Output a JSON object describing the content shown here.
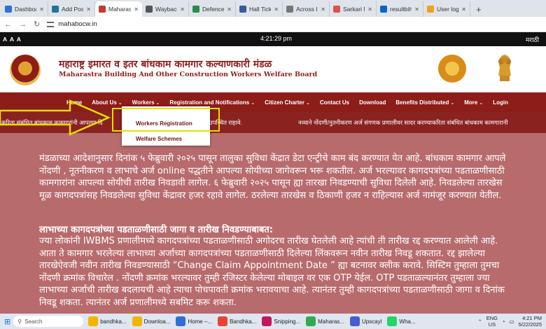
{
  "browser": {
    "tabs": [
      {
        "label": "Dashboard",
        "color": "#2f6fd6"
      },
      {
        "label": "Add Post",
        "color": "#21759b"
      },
      {
        "label": "Maharashtra",
        "color": "#c23a2b",
        "active": true
      },
      {
        "label": "Wayback",
        "color": "#555555"
      },
      {
        "label": "Defence J",
        "color": "#2a8c4a"
      },
      {
        "label": "Hall Ticket",
        "color": "#3b5998"
      },
      {
        "label": "Across Ind",
        "color": "#777777"
      },
      {
        "label": "Sarkari N",
        "color": "#d9534f"
      },
      {
        "label": "resultbiha",
        "color": "#0a66c2"
      },
      {
        "label": "User login",
        "color": "#f0a020"
      }
    ],
    "new_tab": "+",
    "url": "mahabocw.in"
  },
  "topbar": {
    "font_controls": "A A A",
    "time": "4:21:29 pm",
    "language": "मराठी"
  },
  "header": {
    "title_marathi": "महाराष्ट्र इमारत व इतर बांधकाम कामगार कल्याणकारी मंडळ",
    "title_english": "Maharastra Building And Other Construction Workers Welfare Board"
  },
  "nav": {
    "items": [
      {
        "label": "Home",
        "caret": false
      },
      {
        "label": "About Us",
        "caret": true
      },
      {
        "label": "Workers",
        "caret": true
      },
      {
        "label": "Registration and Notifications",
        "caret": true
      },
      {
        "label": "Citizen Charter",
        "caret": true
      },
      {
        "label": "Contact Us",
        "caret": false
      },
      {
        "label": "Download",
        "caret": false
      },
      {
        "label": "Benefits Distributed",
        "caret": true
      },
      {
        "label": "More",
        "caret": true
      },
      {
        "label": "Login",
        "caret": false
      }
    ],
    "caret_glyph": "⌄"
  },
  "ticker": {
    "part1": "करिता संबंधित बांधकाम कामगारांनी आपल्या दि",
    "part2": "सुविधा केंद्रात उपस्थित राहावे.",
    "part3": "नव्याने नोंदणी/नुतनीकरण अर्ज संगणक प्रणालीवर सादर करण्याकरिता संबंधित बांधकाम कामगारानी"
  },
  "dropdown": {
    "items": [
      "Workers Registration",
      "Welfare Schemes"
    ]
  },
  "content": {
    "paragraph1": "मंडळाच्या आदेशानुसार दिनांक ५ फेब्रुवारी २०२५ पासून तालुका सुविधा केंद्रात डेटा एन्ट्रीचे काम बंद करण्यात येत आहे. बांधकाम कामगार आपले नोंदणी , नूतनीकरण व लाभाचे अर्ज online पद्धतीने आपल्या सोयीच्या जागेवरून भरू शकतील. अर्ज भरल्यावर कागदपत्रांच्या पडताळणीसाठी कामगारांना आपल्या सोयीची तारीख निवडावी लागेल. ६ फेब्रुवारी २०२५ पासून ह्या तारखा निवडण्याची सुविधा दिलेली आहे. निवडलेल्या तारखेस मूळ कागदपत्रांसह निवडलेल्या सुविधा केंद्रावर हजर रहावे लागेल. ठरलेल्या तारखेस व ठिकाणी हजर न राहिल्यास अर्ज नामंजूर करण्यात येतील.",
    "heading": "लाभाच्या कागदपत्रांच्या पडताळणीसाठी जागा व तारीख निवडण्याबाबत:",
    "paragraph2": "ज्या लोकांनी IWBMS प्रणालीमध्ये कागदपत्रांच्या पडताळणीसाठी अगोदरच तारीख घेतलेली आहे त्यांची ती तारीख रद्द करण्यात आलेली आहे. आता ते कामगार भरलेल्या लाभाच्या अर्जाच्या कागदपत्रांच्या पडताळणीसाठी दिलेल्या लिंकवरून नवीन तारीख निवडू शकतात. रद्द झालेल्या तारखेऐवजी नवीन तारीख निवडण्यासाठी “Change Claim Appointment Date ” ह्या बटनावर क्लीक करावे. सिस्टिम तुम्हाला तुमचा नोंदणी क्रमांक विचारेल . नोंदणी क्रमांक भरल्यावर तुम्ही रजिस्टर केलेल्या मोबाइल वर एक OTP येईल. OTP पडताळल्यानंतर तुम्हाला ज्या लाभाच्या अर्जाची तारीख बदलायची आहे त्याचा पोचपावती क्रमांक भरावयाचा आहे. त्यानंतर तुम्ही कागदपत्रांच्या पडताळणीसाठी जागा व दिनांक निवडू शकता. त्यानंतर अर्ज प्रणालीमध्ये सबमिट करू शकता."
  },
  "taskbar": {
    "search_placeholder": "Search",
    "apps": [
      {
        "label": "bandhka...",
        "color": "#f4b400"
      },
      {
        "label": "Downloa...",
        "color": "#f4b400"
      },
      {
        "label": "Home –...",
        "color": "#2f6fd6"
      },
      {
        "label": "Bandhka...",
        "color": "#e94235"
      },
      {
        "label": "Snipping...",
        "color": "#c2185b"
      },
      {
        "label": "Maharas...",
        "color": "#34a853"
      },
      {
        "label": "Upscayl",
        "color": "#4a5bd4"
      },
      {
        "label": "Wha...",
        "color": "#25d366"
      }
    ],
    "lang": "ENG",
    "region": "US",
    "time": "4:21 PM",
    "date": "5/22/2025"
  }
}
